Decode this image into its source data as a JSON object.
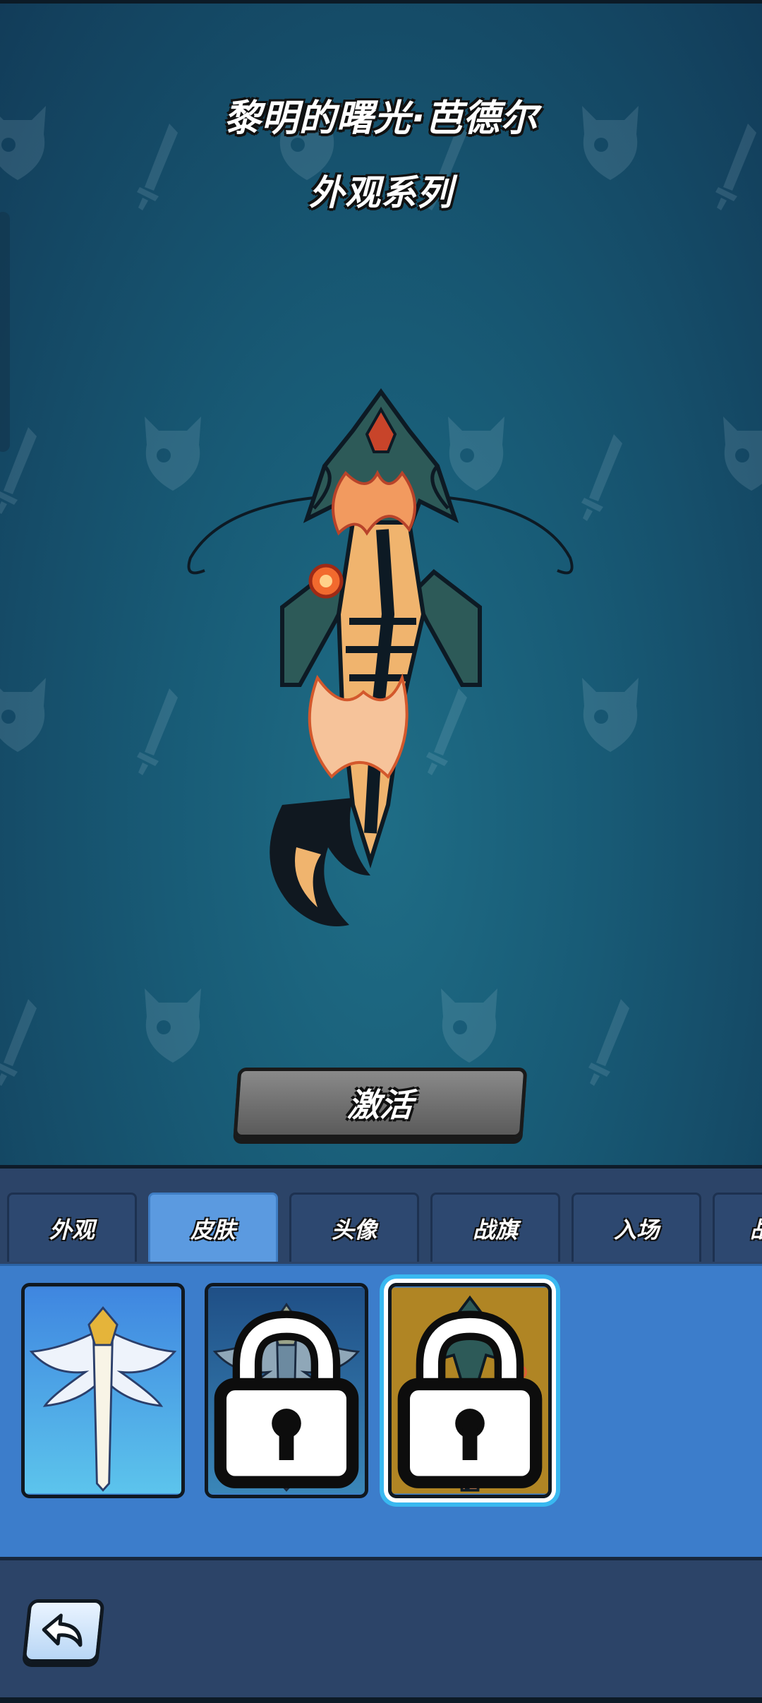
{
  "header": {
    "title": "黎明的曙光·芭德尔",
    "subtitle": "外观系列"
  },
  "actions": {
    "activate_label": "激活"
  },
  "tabs": [
    {
      "label": "外观",
      "active": false
    },
    {
      "label": "皮肤",
      "active": true
    },
    {
      "label": "头像",
      "active": false
    },
    {
      "label": "战旗",
      "active": false
    },
    {
      "label": "入场",
      "active": false
    },
    {
      "label": "战",
      "active": false
    }
  ],
  "skins": [
    {
      "name": "white-gold-winged-sword",
      "locked": false,
      "selected": false
    },
    {
      "name": "dark-winged-sword",
      "locked": true,
      "selected": false
    },
    {
      "name": "flame-dragon-sword",
      "locked": true,
      "selected": true
    }
  ],
  "icons": {
    "back": "back-arrow-icon",
    "lock": "lock-icon"
  },
  "colors": {
    "background": "#185b76",
    "panel": "#2c4468",
    "skin_area": "#3c7dcb",
    "active_tab": "#5b9ae0",
    "selected_glow": "#39b8f0"
  }
}
